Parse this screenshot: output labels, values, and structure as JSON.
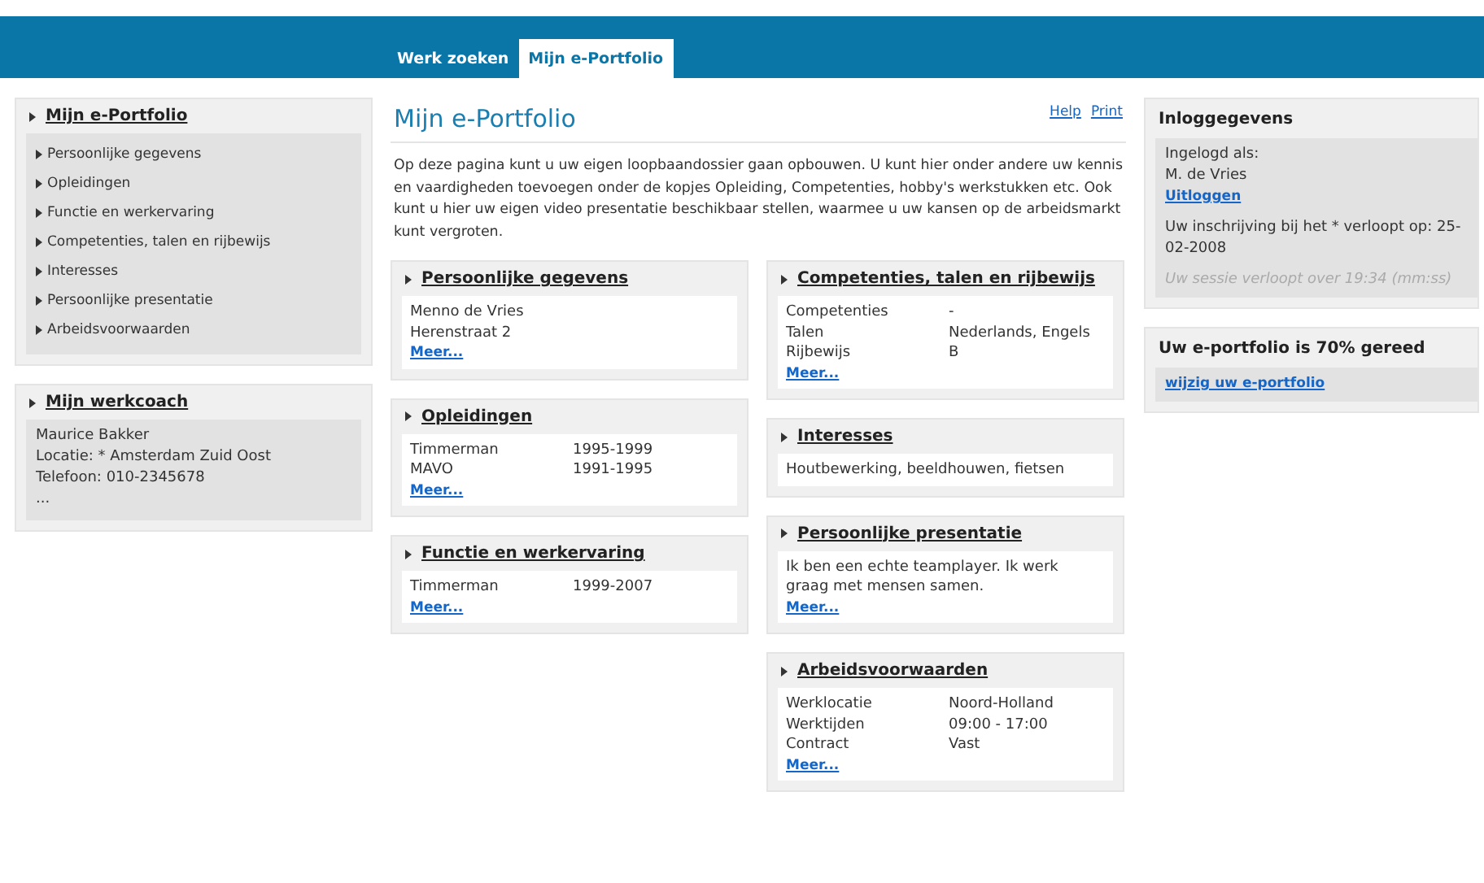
{
  "tabs": [
    {
      "label": "Werk zoeken",
      "selected": false
    },
    {
      "label": "Mijn e-Portfolio",
      "selected": true
    }
  ],
  "sidebar": {
    "portfolio": {
      "title": "Mijn e-Portfolio",
      "items": [
        "Persoonlijke gegevens",
        "Opleidingen",
        "Functie en werkervaring",
        "Competenties, talen en rijbewijs",
        "Interesses",
        "Persoonlijke presentatie",
        "Arbeidsvoorwaarden"
      ]
    },
    "coach": {
      "title": "Mijn werkcoach",
      "lines": [
        "Maurice Bakker",
        "Locatie: * Amsterdam Zuid Oost",
        "Telefoon: 010-2345678",
        "..."
      ]
    }
  },
  "main": {
    "title": "Mijn e-Portfolio",
    "links": [
      "Help",
      "Print"
    ],
    "intro": "Op deze pagina kunt u uw eigen loopbaandossier gaan opbouwen. U kunt hier onder andere uw kennis en vaardigheden toevoegen onder de kopjes Opleiding, Competenties, hobby's werkstukken etc. Ook kunt u hier uw eigen video presentatie beschikbaar stellen, waarmee u uw kansen op de arbeidsmarkt kunt vergroten.",
    "columns": [
      [
        {
          "title": "Persoonlijke gegevens",
          "kind": "lines",
          "lines": [
            "Menno de Vries",
            "Herenstraat 2"
          ],
          "more": "Meer..."
        },
        {
          "title": "Opleidingen",
          "kind": "rows",
          "rows": [
            {
              "label": "Timmerman",
              "value": "1995-1999"
            },
            {
              "label": "MAVO",
              "value": "1991-1995"
            }
          ],
          "more": "Meer..."
        },
        {
          "title": "Functie en werkervaring",
          "kind": "rows",
          "rows": [
            {
              "label": "Timmerman",
              "value": "1999-2007"
            }
          ],
          "more": "Meer..."
        }
      ],
      [
        {
          "title": "Competenties, talen en rijbewijs",
          "kind": "rows",
          "rows": [
            {
              "label": "Competenties",
              "value": "-"
            },
            {
              "label": "Talen",
              "value": "Nederlands, Engels"
            },
            {
              "label": "Rijbewijs",
              "value": "B"
            }
          ],
          "more": "Meer..."
        },
        {
          "title": "Interesses",
          "kind": "lines",
          "lines": [
            "Houtbewerking, beeldhouwen, fietsen"
          ]
        },
        {
          "title": "Persoonlijke presentatie",
          "kind": "lines",
          "lines": [
            "Ik ben een echte teamplayer. Ik werk graag met mensen samen."
          ],
          "more": "Meer..."
        },
        {
          "title": "Arbeidsvoorwaarden",
          "kind": "rows",
          "rows": [
            {
              "label": "Werklocatie",
              "value": "Noord-Holland"
            },
            {
              "label": "Werktijden",
              "value": "09:00 - 17:00"
            },
            {
              "label": "Contract",
              "value": "Vast"
            }
          ],
          "more": "Meer..."
        }
      ]
    ]
  },
  "login": {
    "title": "Inloggegevens",
    "label": "Ingelogd als:",
    "user": "M. de Vries",
    "logout": "Uitloggen",
    "expiry": "Uw inschrijving bij het * verloopt op: 25-02-2008",
    "session": "Uw sessie verloopt over 19:34 (mm:ss)"
  },
  "progress": {
    "title": "Uw e-portfolio is 70% gereed",
    "link": "wijzig uw e-portfolio"
  }
}
